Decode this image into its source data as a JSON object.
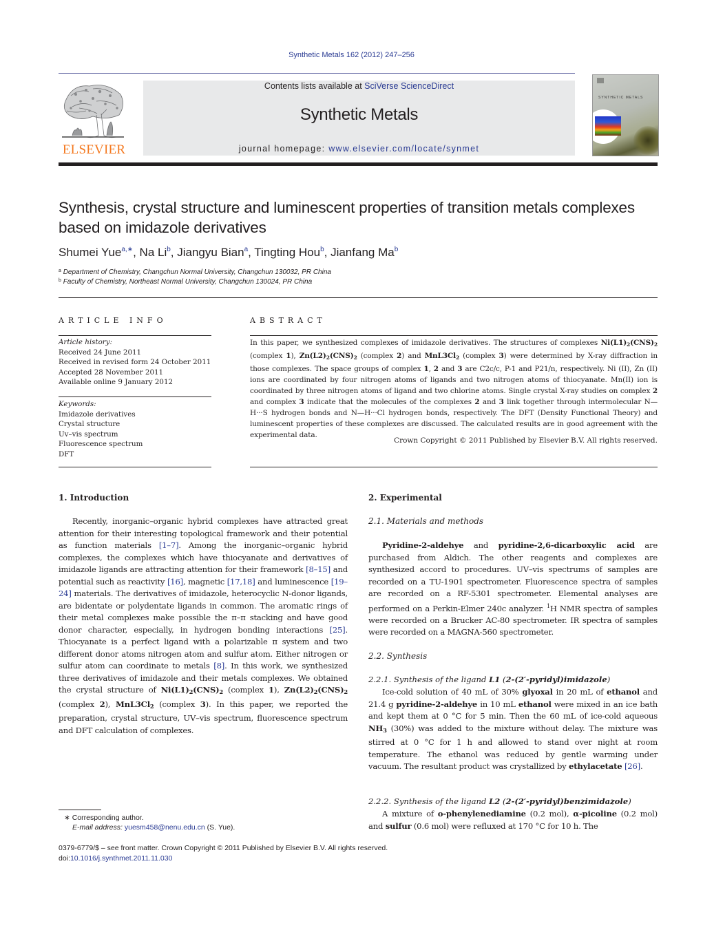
{
  "citation": "Synthetic Metals 162 (2012) 247–256",
  "header": {
    "publisher_logo_text": "ELSEVIER",
    "contents_prefix": "Contents lists available at ",
    "contents_link": "SciVerse ScienceDirect",
    "journal_title": "Synthetic Metals",
    "homepage_prefix": "journal homepage: ",
    "homepage_link": "www.elsevier.com/locate/synmet",
    "cover_title": "SYNTHETIC METALS"
  },
  "title": "Synthesis, crystal structure and luminescent properties of transition metals complexes based on imidazole derivatives",
  "authors": [
    {
      "name": "Shumei Yue",
      "sup": "a,∗"
    },
    {
      "name": "Na Li",
      "sup": "b"
    },
    {
      "name": "Jiangyu Bian",
      "sup": "a"
    },
    {
      "name": "Tingting Hou",
      "sup": "b"
    },
    {
      "name": "Jianfang Ma",
      "sup": "b"
    }
  ],
  "affiliations": [
    {
      "mark": "a",
      "text": "Department of Chemistry, Changchun Normal University, Changchun 130032, PR China"
    },
    {
      "mark": "b",
      "text": "Faculty of Chemistry, Northeast Normal University, Changchun 130024, PR China"
    }
  ],
  "article_info": {
    "heading": "ARTICLE INFO",
    "history_label": "Article history:",
    "history": [
      "Received 24 June 2011",
      "Received in revised form 24 October 2011",
      "Accepted 28 November 2011",
      "Available online 9 January 2012"
    ],
    "keywords_label": "Keywords:",
    "keywords": [
      "Imidazole derivatives",
      "Crystal structure",
      "Uv–vis spectrum",
      "Fluorescence spectrum",
      "DFT"
    ]
  },
  "abstract": {
    "heading": "ABSTRACT",
    "s1": "In this paper, we synthesized complexes of imidazole derivatives. The structures of complexes ",
    "c1": "Ni(L1)",
    "c1b": "(CNS)",
    "s2": " (complex ",
    "n1": "1",
    "s3": "), ",
    "c2": "Zn(L2)",
    "c2b": "(CNS)",
    "s4": " (complex ",
    "n2": "2",
    "s5": ") and ",
    "c3": "MnL3Cl",
    "s6": " (complex ",
    "n3": "3",
    "s7": ") were determined by X-ray diffraction in those complexes. The space groups of complex ",
    "s8": ", ",
    "s9": " and ",
    "s10": " are C2c/c, P-1 and P21/n, respectively. Ni (II), Zn (II) ions are coordinated by four nitrogen atoms of ligands and two nitrogen atoms of thiocyanate. Mn(II) ion is coordinated by three nitrogen atoms of ligand and two chlorine atoms. Single crystal X-ray studies on complex ",
    "s11": " and complex ",
    "s12": " indicate that the molecules of the complexes ",
    "s13": " and ",
    "s14": " link together through intermolecular N—H···S hydrogen bonds and N—H···Cl hydrogen bonds, respectively. The DFT (Density Functional Theory) and luminescent properties of these complexes are discussed. The calculated results are in good agreement with the experimental data.",
    "sub2": "2",
    "copyright": "Crown Copyright © 2011 Published by Elsevier B.V. All rights reserved."
  },
  "introduction": {
    "heading": "1.  Introduction",
    "t1": "Recently, inorganic–organic hybrid complexes have attracted great attention for their interesting topological framework and their potential as function materials ",
    "r1": "[1–7]",
    "t2": ". Among the inorganic–organic hybrid complexes, the complexes which have thiocyanate and derivatives of imidazole ligands are attracting attention for their framework ",
    "r2": "[8–15]",
    "t3": " and potential such as reactivity ",
    "r3": "[16]",
    "t4": ", magnetic ",
    "r4": "[17,18]",
    "t5": " and luminescence ",
    "r5": "[19–24]",
    "t6": " materials. The derivatives of imidazole, heterocyclic N-donor ligands, are bidentate or polydentate ligands in common. The aromatic rings of their metal complexes make possible the π–π stacking and have good donor character, especially, in hydrogen bonding interactions ",
    "r6": "[25]",
    "t7": ". Thiocyanate is a perfect ligand with a polarizable π system and two different donor atoms nitrogen atom and sulfur atom. Either nitrogen or sulfur atom can coordinate to metals ",
    "r7": "[8]",
    "t8": ". In this work, we synthesized three derivatives of imidazole and their metals complexes. We obtained the crystal structure of ",
    "t9": " (complex ",
    "t10": "), ",
    "t11": ", ",
    "t12": "). In this paper, we reported the preparation, crystal structure, UV–vis spectrum, fluorescence spectrum and DFT calculation of complexes."
  },
  "experimental": {
    "heading": "2.  Experimental",
    "mm_heading": "2.1.  Materials and methods",
    "mm_b1": "Pyridine-2-aldehye",
    "mm_t1": " and ",
    "mm_b2": "pyridine-2,6-dicarboxylic acid",
    "mm_t2": " are purchased from Aldich. The other reagents and complexes are synthesized accord to procedures. UV–vis spectrums of samples are recorded on a TU-1901 spectrometer. Fluorescence spectra of samples are recorded on a RF-5301 spectrometer. Elemental analyses are performed on a Perkin-Elmer 240c analyzer. ",
    "mm_sup": "1",
    "mm_t3": "H NMR spectra of samples were recorded on a Brucker AC-80 spectrometer. IR spectra of samples were recorded on a MAGNA-560 spectrometer.",
    "syn_heading": "2.2.  Synthesis",
    "syn1_prefix": "2.2.1.  Synthesis of the ligand ",
    "syn1_ligand": "L1",
    "syn1_paren_open": " (",
    "syn1_name": "2-(2′-pyridyl)imidazole",
    "syn1_paren_close": ")",
    "syn1_t1": "Ice-cold solution of 40 mL of 30% ",
    "syn1_b1": "glyoxal",
    "syn1_t2": " in 20 mL of ",
    "syn1_b2": "ethanol",
    "syn1_t3": " and 21.4 g ",
    "syn1_b3": "pyridine-2-aldehye",
    "syn1_t4": " in 10 mL ",
    "syn1_b4": "ethanol",
    "syn1_t5": " were mixed in an ice bath and kept them at 0 °C for 5 min. Then the 60 mL of ice-cold aqueous ",
    "syn1_b5": "NH",
    "syn1_sub": "3",
    "syn1_t6": " (30%) was added to the mixture without delay. The mixture was stirred at 0 °C for 1 h and allowed to stand over night at room temperature. The ethanol was reduced by gentle warming under vacuum. The resultant product was crystallized by ",
    "syn1_b6": "ethylacetate",
    "syn1_t7": " ",
    "syn1_ref": "[26]",
    "syn1_t8": ".",
    "syn2_prefix": "2.2.2.  Synthesis of the ligand ",
    "syn2_ligand": "L2",
    "syn2_paren_open": " (",
    "syn2_name": "2-(2′-pyridyl)benzimidazole",
    "syn2_paren_close": ")",
    "syn2_t1": "A mixture of ",
    "syn2_b1": "o-phenylenediamine",
    "syn2_t2": " (0.2 mol), ",
    "syn2_b2": "α-picoline",
    "syn2_t3": " (0.2 mol) and ",
    "syn2_b3": "sulfur",
    "syn2_t4": " (0.6 mol) were refluxed at 170 °C for 10 h. The"
  },
  "footnotes": {
    "corresponding": "∗ Corresponding author.",
    "email_label": "E-mail address: ",
    "email": "yuesm458@nenu.edu.cn",
    "email_suffix": " (S. Yue).",
    "front_matter": "0379-6779/$ – see front matter. Crown Copyright © 2011 Published by Elsevier B.V. All rights reserved.",
    "doi_prefix": "doi:",
    "doi": "10.1016/j.synthmet.2011.11.030"
  },
  "colors": {
    "link": "#2a3b93",
    "elsevier_orange": "#f47920",
    "header_box": "#e8e9ea"
  }
}
